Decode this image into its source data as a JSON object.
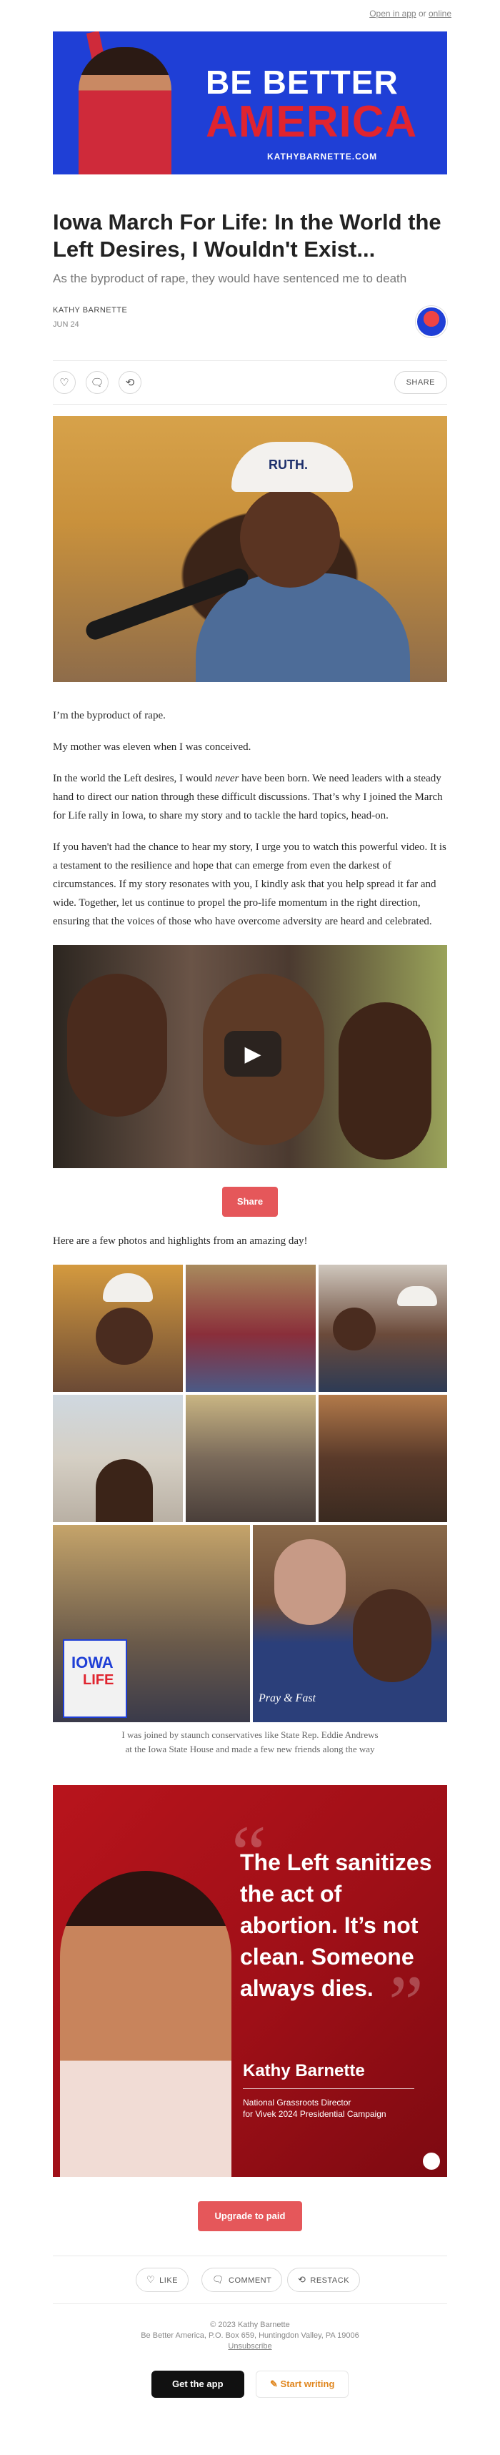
{
  "topbar": {
    "open_in_app": "Open in app",
    "or": "or",
    "online": "online"
  },
  "banner": {
    "line1": "BE BETTER",
    "line2": "AMERICA",
    "site": "KATHYBARNETTE.COM"
  },
  "post": {
    "title": "Iowa March For Life: In the World the Left Desires, I Wouldn't Exist...",
    "subtitle": "As the byproduct of rape, they would have sentenced me to death",
    "author": "KATHY BARNETTE",
    "date": "JUN 24"
  },
  "actions": {
    "share_label": "SHARE",
    "icons": [
      "heart-icon",
      "comment-icon",
      "restack-icon"
    ]
  },
  "photo_main": {
    "cap_text": "RUTH."
  },
  "body": {
    "p1": "I’m the byproduct of rape.",
    "p2": "My mother was eleven when I was conceived.",
    "p3a": "In the world the Left desires, I would ",
    "p3em": "never",
    "p3b": " have been born. We need leaders with a steady hand to direct our nation through these difficult discussions. That’s why I joined the March for Life rally in Iowa, to share my story and to tackle the hard topics, head-on.",
    "p4": "If you haven't had the chance to hear my story, I urge you to watch this powerful video. It is a testament to the resilience and hope that can emerge from even the darkest of circumstances. If my story resonates with you, I kindly ask that you help spread it far and wide. Together, let us continue to propel the pro-life momentum in the right direction, ensuring that the voices of those who have overcome adversity are heard and celebrated."
  },
  "share_button": "Share",
  "highlights_intro": "Here are a few photos and highlights from an amazing day!",
  "gallery": {
    "sign_text_1": "IOWA",
    "sign_text_2": "LIFE",
    "shirt_text": "Pray & Fast"
  },
  "gallery_caption": {
    "line1": "I was joined by staunch conservatives like State Rep. Eddie Andrews",
    "line2": "at the Iowa State House and made a few new friends along the way"
  },
  "quote_card": {
    "text": "The Left sanitizes the act of abortion. It’s not clean. Someone always dies.",
    "name": "Kathy Barnette",
    "role_line1": "National Grassroots Director",
    "role_line2": "for Vivek 2024 Presidential Campaign"
  },
  "upgrade_button": "Upgrade to paid",
  "bottom_actions": {
    "like": "LIKE",
    "comment": "COMMENT",
    "restack": "RESTACK"
  },
  "footer": {
    "copyright": "© 2023 Kathy Barnette",
    "address": "Be Better America, P.O. Box 659, Huntingdon Valley, PA 19006",
    "unsubscribe": "Unsubscribe"
  },
  "app_buttons": {
    "get_app": "Get the app",
    "start_writing": "Start writing"
  },
  "colors": {
    "accent": "#e5575a",
    "banner_blue": "#1f3fd6",
    "banner_red": "#e0242f",
    "quote_red": "#b8141c"
  }
}
